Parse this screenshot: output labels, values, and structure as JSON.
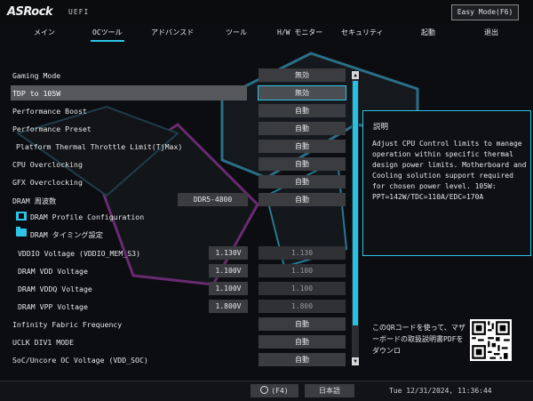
{
  "brand": {
    "logo": "ASRock",
    "sub": "UEFI"
  },
  "easy_mode_label": "Easy Mode(F6)",
  "tabs": [
    {
      "label": "メイン"
    },
    {
      "label": "OCツール",
      "active": true
    },
    {
      "label": "アドバンスド"
    },
    {
      "label": "ツール"
    },
    {
      "label": "H/W モニター"
    },
    {
      "label": "セキュリティ"
    },
    {
      "label": "起動"
    },
    {
      "label": "退出"
    }
  ],
  "settings": [
    {
      "label": "Gaming Mode",
      "value": "無効"
    },
    {
      "label": "TDP to 105W",
      "value": "無効",
      "selected": true
    },
    {
      "label": "Performance Boost",
      "value": "自動"
    },
    {
      "label": "Performance Preset",
      "value": "自動"
    },
    {
      "label": "Platform Thermal Throttle Limit(TjMax)",
      "value": "自動"
    },
    {
      "label": "CPU Overclocking",
      "value": "自動"
    },
    {
      "label": "GFX Overclocking",
      "value": "自動"
    },
    {
      "label": "DRAM 周波数",
      "current": "DDR5-4800",
      "value": "自動"
    },
    {
      "label": "DRAM Profile Configuration",
      "icon": "memory-icon"
    },
    {
      "label": "DRAM タイミング設定",
      "icon": "folder-icon"
    },
    {
      "label": "VDDIO Voltage (VDDIO_MEM_S3)",
      "current": "1.130V",
      "value": "1.130",
      "dim": true
    },
    {
      "label": "DRAM VDD Voltage",
      "current": "1.100V",
      "value": "1.100",
      "dim": true
    },
    {
      "label": "DRAM VDDQ Voltage",
      "current": "1.100V",
      "value": "1.100",
      "dim": true
    },
    {
      "label": "DRAM VPP Voltage",
      "current": "1.800V",
      "value": "1.800",
      "dim": true
    },
    {
      "label": "Infinity Fabric Frequency",
      "value": "自動"
    },
    {
      "label": "UCLK DIV1 MODE",
      "value": "自動"
    },
    {
      "label": "SoC/Uncore OC Voltage (VDD_SOC)",
      "value": "自動"
    }
  ],
  "help": {
    "title": "説明",
    "text": "Adjust CPU Control limits to manage operation within specific thermal design power limits. Motherboard and Cooling solution support required for chosen power level. 105W: PPT=142W/TDC=110A/EDC=170A"
  },
  "qr_text": "このQRコードを使って、マザーボードの取扱説明書PDFをダウンロ",
  "footer": {
    "search_label": "(F4)",
    "language": "日本語",
    "datetime": "Tue 12/31/2024, 11:36:44"
  },
  "colors": {
    "accent": "#2ec4e8",
    "background": "#0b0d10"
  }
}
